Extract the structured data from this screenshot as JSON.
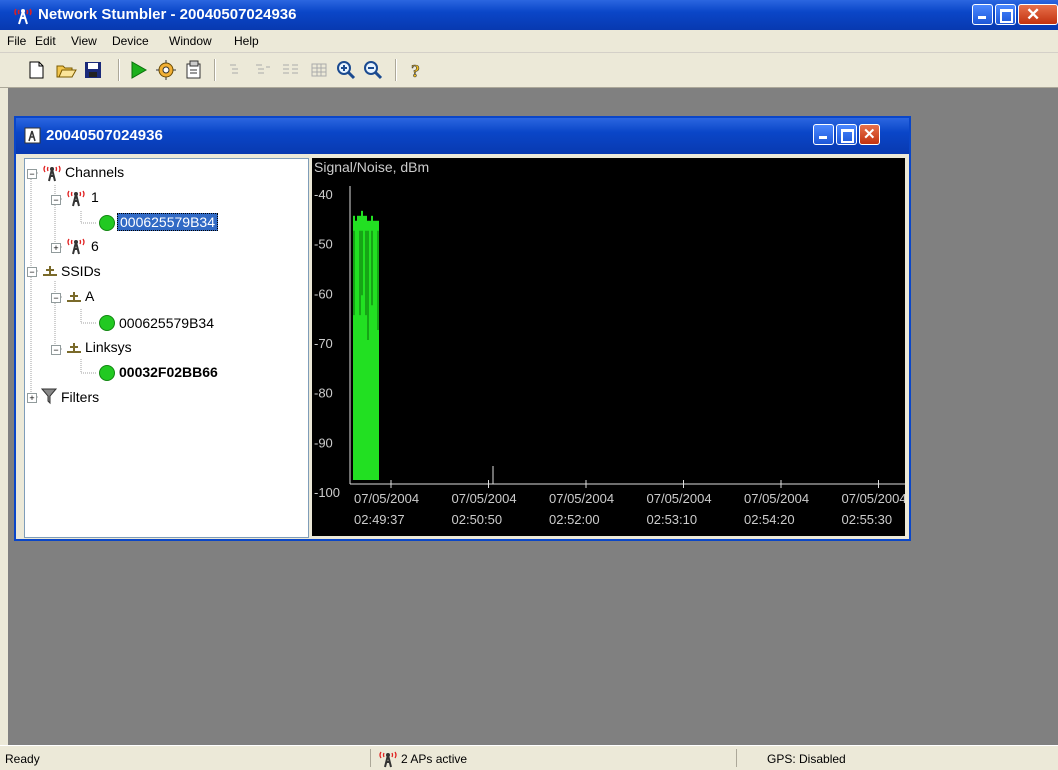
{
  "app": {
    "title": "Network Stumbler - 20040507024936"
  },
  "menu": [
    "File",
    "Edit",
    "View",
    "Device",
    "Window",
    "Help"
  ],
  "toolbar": {
    "buttons": [
      "new-icon",
      "open-icon",
      "save-icon",
      "play-icon",
      "scan-icon",
      "properties-icon",
      "list-view-icon",
      "tree-view-icon",
      "detail-view-icon",
      "grid-icon",
      "zoom-in-icon",
      "zoom-out-icon",
      "help-icon"
    ]
  },
  "child": {
    "title": "20040507024936"
  },
  "tree": {
    "channels": "Channels",
    "channel_1": "1",
    "ap_1": "000625579B34",
    "channel_6": "6",
    "ssids": "SSIDs",
    "ssid_a": "A",
    "ap_a": "000625579B34",
    "ssid_linksys": "Linksys",
    "ap_linksys": "00032F02BB66",
    "filters": "Filters"
  },
  "chart_data": {
    "type": "bar",
    "title": "Signal/Noise, dBm",
    "ylim": [
      -100,
      -40
    ],
    "yticks": [
      "-40",
      "-50",
      "-60",
      "-70",
      "-80",
      "-90",
      "-100"
    ],
    "xticks": [
      {
        "date": "07/05/2004",
        "time": "02:49:37"
      },
      {
        "date": "07/05/2004",
        "time": "02:50:50"
      },
      {
        "date": "07/05/2004",
        "time": "02:52:00"
      },
      {
        "date": "07/05/2004",
        "time": "02:53:10"
      },
      {
        "date": "07/05/2004",
        "time": "02:54:20"
      },
      {
        "date": "07/05/2004",
        "time": "02:55:30"
      }
    ],
    "series_color": "#22e022",
    "values": [
      -46,
      -47,
      -46,
      -46,
      -45,
      -46,
      -46,
      -47,
      -47,
      -46,
      -47,
      -47,
      -47
    ],
    "noise_values": [
      -66,
      -66,
      -64,
      -66,
      -62,
      -66,
      -66,
      -71,
      -71,
      -64,
      -69,
      -69,
      -69
    ]
  },
  "status": {
    "ready": "Ready",
    "aps": "2 APs active",
    "gps": "GPS: Disabled"
  }
}
